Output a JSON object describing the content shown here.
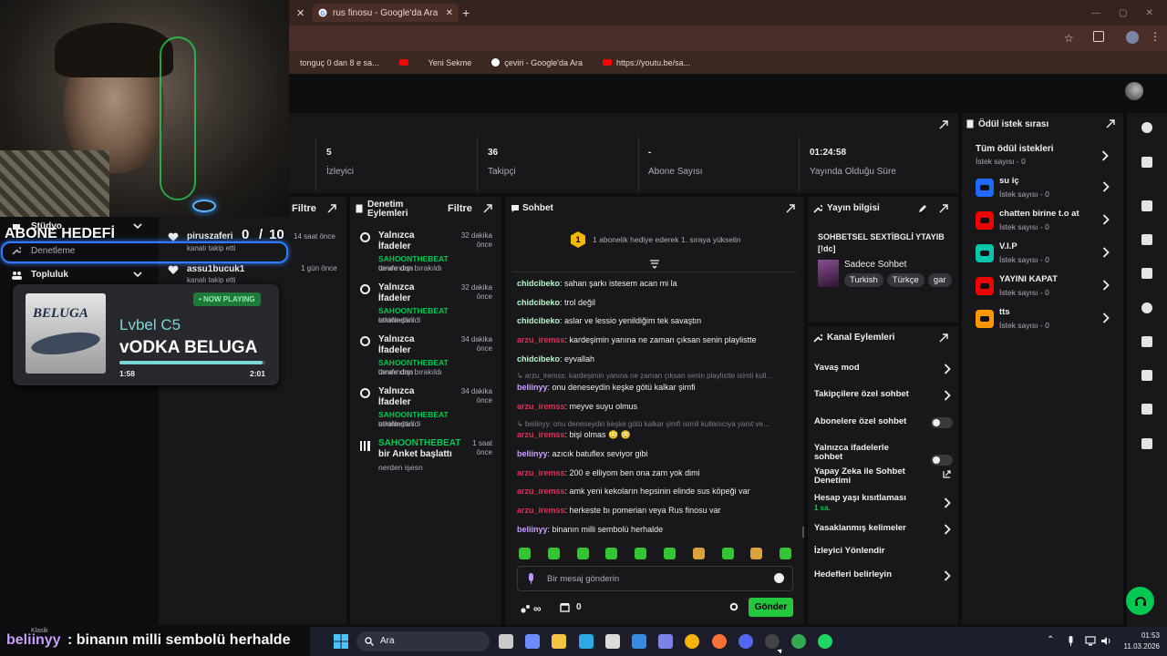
{
  "browser": {
    "tabs": [
      {
        "label": "rus finosu - Google'da Ara"
      }
    ],
    "bookmarks": [
      {
        "label": "tonguç 0 dan 8 e sa..."
      },
      {
        "label": ""
      },
      {
        "label": "Yeni Sekme"
      },
      {
        "label": "çeviri - Google'da Ara"
      },
      {
        "label": "https://youtu.be/sa..."
      }
    ]
  },
  "stats": [
    {
      "value": "5",
      "label": "İzleyici"
    },
    {
      "value": "36",
      "label": "Takipçi"
    },
    {
      "value": "-",
      "label": "Abone Sayısı"
    },
    {
      "value": "01:24:58",
      "label": "Yayında Olduğu Süre"
    }
  ],
  "left_panel": {
    "filter_label": "Filtre",
    "activity": [
      {
        "name": "piruszaferi",
        "text": "kanalı takip etti",
        "time": "14 saat önce"
      },
      {
        "name": "assu1bucuk1",
        "text": "kanalı takip etti",
        "time": "1 gün önce"
      }
    ]
  },
  "overlay": {
    "abone_hedefi": "ABONE HEDEFİ",
    "goal_current": "0",
    "goal_sep": "/",
    "goal_total": "10",
    "nav": [
      {
        "label": "Stüdyo"
      },
      {
        "label": "Denetleme"
      },
      {
        "label": "Topluluk"
      }
    ],
    "now_playing_label": "• NOW PLAYING",
    "album_text": "BELUGA",
    "artist": "Lvbel C5",
    "track": "vODKA BELUGA",
    "time_elapsed": "1:58",
    "time_total": "2:01",
    "progress": 0.98,
    "caption_user": "beliinyy",
    "caption_text": ": binanın milli sembolü herhalde",
    "caption_small": "Klasik"
  },
  "moderation": {
    "title": "Denetim Eylemleri",
    "filter_label": "Filtre",
    "items": [
      {
        "title": "Yalnızca İfadeler",
        "actor": "SAHOONTHEBEAT",
        "suffix": "tarafından",
        "detail": "devre dışı bırakıldı",
        "time": "32 dakika önce"
      },
      {
        "title": "Yalnızca İfadeler",
        "actor": "SAHOONTHEBEAT",
        "suffix": "tarafından",
        "detail": "etkinleştirildi",
        "time": "32 dakika önce"
      },
      {
        "title": "Yalnızca İfadeler",
        "actor": "SAHOONTHEBEAT",
        "suffix": "tarafından",
        "detail": "devre dışı bırakıldı",
        "time": "34 dakika önce"
      },
      {
        "title": "Yalnızca İfadeler",
        "actor": "SAHOONTHEBEAT",
        "suffix": "tarafından",
        "detail": "etkinleştirildi",
        "time": "34 dakika önce"
      },
      {
        "title": "Anket başlattı",
        "actor": "SAHOONTHEBEAT",
        "suffix": "bir",
        "detail": "nerden işesn",
        "time": "1 saat önce"
      }
    ]
  },
  "chat": {
    "title": "Sohbet",
    "gift_rank": "1",
    "gift_text": "1 abonelik hediye ederek 1. sıraya yükselin",
    "messages": [
      {
        "user": "chidcibeko",
        "color": "#b9f6ca",
        "text": ": sahan şarkı istesem acan mi la"
      },
      {
        "user": "chidcibeko",
        "color": "#b9f6ca",
        "text": ": trol değil"
      },
      {
        "user": "chidcibeko",
        "color": "#b9f6ca",
        "text": ": aslar ve lessio yenildiğim tek savaştın"
      },
      {
        "user": "arzu_iremss",
        "color": "#e0325a",
        "text": ": kardeşimin yanına ne zaman çıksan senin playlistte"
      },
      {
        "user": "chidcibeko",
        "color": "#b9f6ca",
        "text": ": eyvallah"
      },
      {
        "reply": "↳ arzu_iremss: kardeşimin yanına ne zaman çıksan senin playlistte isimli kull..."
      },
      {
        "user": "beliinyy",
        "color": "#c9a0ff",
        "text": ": onu deneseydin keşke götü kalkar şimfi"
      },
      {
        "user": "arzu_iremss",
        "color": "#e0325a",
        "text": ": meyve suyu olmus"
      },
      {
        "reply": "↳ beliinyy: onu deneseydin keşke götü kalkar şimfi isimli kullanıcıya yanıt ve..."
      },
      {
        "user": "arzu_iremss",
        "color": "#e0325a",
        "text": ": bişi olmas 😳 😳"
      },
      {
        "user": "beliinyy",
        "color": "#c9a0ff",
        "text": ": azıcık batuflex seviyor gibi"
      },
      {
        "user": "arzu_iremss",
        "color": "#e0325a",
        "text": ": 200 e elliyom ben ona zam yok dimi"
      },
      {
        "user": "arzu_iremss",
        "color": "#e0325a",
        "text": ": amk yeni kekoların hepsinin elinde sus köpeği var"
      },
      {
        "user": "arzu_iremss",
        "color": "#e0325a",
        "text": ": herkeste bı pomerian veya Rus finosu var"
      },
      {
        "user": "beliinyy",
        "color": "#c9a0ff",
        "text": ": binanın milli sembolü herhalde"
      }
    ],
    "input_placeholder": "Bir mesaj gönderin",
    "infinite": "∞",
    "points": "0",
    "send_label": "Gönder"
  },
  "stream_info": {
    "title": "Yayın bilgisi",
    "stream_title": "SOHBETSEL SEXTİBGLİ YTAYIB [!dc]",
    "category": "Sadece Sohbet",
    "tags": [
      "Turkish",
      "Türkçe",
      "gar"
    ]
  },
  "channel_actions": {
    "title": "Kanal Eylemleri",
    "items": [
      {
        "label": "Yavaş mod",
        "control": "chevron"
      },
      {
        "label": "Takipçilere özel sohbet",
        "control": "chevron"
      },
      {
        "label": "Abonelere özel sohbet",
        "control": "toggle"
      },
      {
        "label": "Yalnızca ifadelerle sohbet",
        "control": "toggle"
      },
      {
        "label": "Yapay Zeka ile Sohbet Denetimi",
        "control": "external"
      },
      {
        "label": "Hesap yaşı kısıtlaması",
        "sub": "1 sa.",
        "control": "chevron"
      },
      {
        "label": "Yasaklanmış kelimeler",
        "control": "chevron"
      },
      {
        "label": "İzleyici Yönlendir",
        "control": "none"
      },
      {
        "label": "Hedefleri belirleyin",
        "control": "chevron"
      }
    ]
  },
  "rewards": {
    "title": "Ödül istek sırası",
    "all_label": "Tüm ödül istekleri",
    "all_count": "İstek sayısı - 0",
    "items": [
      {
        "name": "su iç",
        "count": "İstek sayısı - 0",
        "color": "#1e69ff"
      },
      {
        "name": "chatten birine t.o at",
        "count": "İstek sayısı - 0",
        "color": "#eb0400"
      },
      {
        "name": "V.I.P",
        "count": "İstek sayısı - 0",
        "color": "#00c7ac"
      },
      {
        "name": "YAYINI KAPAT",
        "count": "İstek sayısı - 0",
        "color": "#eb0400"
      },
      {
        "name": "tts",
        "count": "İstek sayısı - 0",
        "color": "#ff9800"
      }
    ]
  },
  "taskbar": {
    "search_label": "Ara",
    "time": "01:53",
    "date": "11.03.2026"
  }
}
